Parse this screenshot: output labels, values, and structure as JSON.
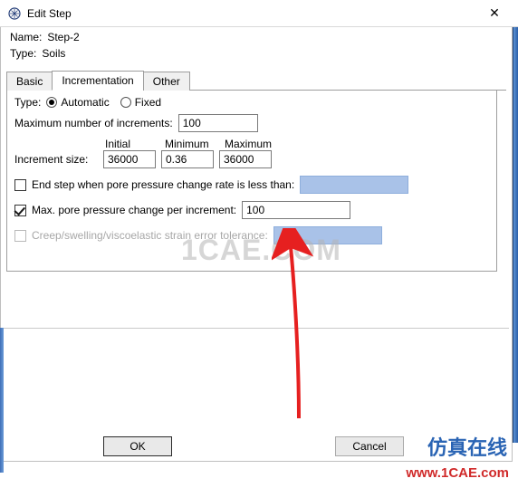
{
  "window": {
    "title": "Edit Step",
    "close": "✕"
  },
  "name": {
    "label": "Name:",
    "value": "Step-2"
  },
  "type": {
    "label": "Type:",
    "value": "Soils"
  },
  "tabs": {
    "basic": "Basic",
    "incrementation": "Incrementation",
    "other": "Other"
  },
  "panel": {
    "type_label": "Type:",
    "automatic": "Automatic",
    "fixed": "Fixed",
    "max_incr_label": "Maximum number of increments:",
    "max_incr_value": "100",
    "head_initial": "Initial",
    "head_minimum": "Minimum",
    "head_maximum": "Maximum",
    "incr_size_label": "Increment size:",
    "incr_initial": "36000",
    "incr_minimum": "0.36",
    "incr_maximum": "36000",
    "end_step_label": "End step when pore pressure change rate is less than:",
    "max_pore_label": "Max. pore pressure change per increment:",
    "max_pore_value": "100",
    "creep_label": "Creep/swelling/viscoelastic strain error tolerance:"
  },
  "buttons": {
    "ok": "OK",
    "cancel": "Cancel"
  },
  "watermark": {
    "cae": "1CAE.COM",
    "cn": "仿真在线",
    "url": "www.1CAE.com"
  }
}
